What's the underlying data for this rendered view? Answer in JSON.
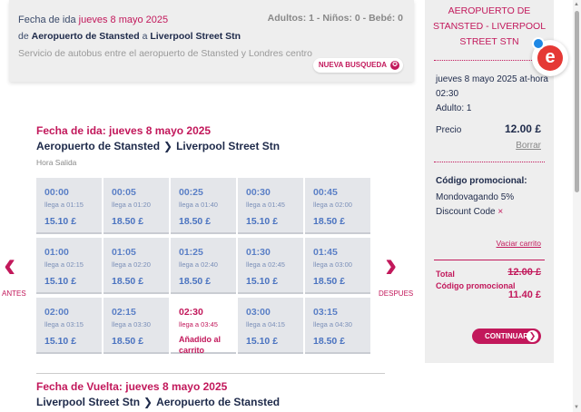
{
  "summary": {
    "label": "Fecha de ida",
    "date": "jueves 8 mayo 2025",
    "passengers": "Adultos: 1 - Niños: 0 - Bebé: 0",
    "de": "de",
    "from": "Aeropuerto de Stansted",
    "a": "a",
    "to": "Liverpool Street Stn",
    "description": "Servicio de autobus entre el aeropuerto de Stansted y Londres centro",
    "new_search": "NUEVA BUSQUEDA",
    "new_search_icon": "✪"
  },
  "outbound": {
    "title": "Fecha de ida: jueves 8 mayo 2025",
    "from": "Aeropuerto de Stansted",
    "to": "Liverpool Street Stn",
    "chevron": "❯",
    "hora_salida": "Hora Salida"
  },
  "departures": [
    {
      "time": "00:00",
      "arrive": "llega a 01:15",
      "price": "15.10 £"
    },
    {
      "time": "00:05",
      "arrive": "llega a 01:20",
      "price": "18.50 £"
    },
    {
      "time": "00:25",
      "arrive": "llega a 01:40",
      "price": "18.50 £"
    },
    {
      "time": "00:30",
      "arrive": "llega a 01:45",
      "price": "15.10 £"
    },
    {
      "time": "00:45",
      "arrive": "llega a 02:00",
      "price": "18.50 £"
    },
    {
      "time": "01:00",
      "arrive": "llega a 02:15",
      "price": "15.10 £"
    },
    {
      "time": "01:05",
      "arrive": "llega a 02:20",
      "price": "18.50 £"
    },
    {
      "time": "01:25",
      "arrive": "llega a 02:40",
      "price": "18.50 £"
    },
    {
      "time": "01:30",
      "arrive": "llega a 02:45",
      "price": "15.10 £"
    },
    {
      "time": "01:45",
      "arrive": "llega a 03:00",
      "price": "18.50 £"
    },
    {
      "time": "02:00",
      "arrive": "llega a 03:15",
      "price": "15.10 £"
    },
    {
      "time": "02:15",
      "arrive": "llega a 03:30",
      "price": "18.50 £"
    },
    {
      "time": "02:30",
      "arrive": "llega a 03:45",
      "price": "",
      "added": "Añadido al carrito",
      "selected": true
    },
    {
      "time": "03:00",
      "arrive": "llega a 04:15",
      "price": "15.10 £"
    },
    {
      "time": "03:15",
      "arrive": "llega a 04:30",
      "price": "18.50 £"
    }
  ],
  "nav": {
    "prev_icon": "‹",
    "prev_label": "ANTES",
    "next_icon": "›",
    "next_label": "DESPUES"
  },
  "return": {
    "title": "Fecha de Vuelta: jueves 8 mayo 2025",
    "from": "Liverpool Street Stn",
    "to": "Aeropuerto de Stansted",
    "chevron": "❯"
  },
  "cart": {
    "route": "AEROPUERTO DE STANSTED - LIVERPOOL STREET STN",
    "trip_info": "jueves 8 mayo 2025 at-hora 02:30",
    "adults": "Adulto: 1",
    "price_label": "Precio",
    "price_value": "12.00 £",
    "delete": "Borrar",
    "promo_title": "Código promocional:",
    "promo_code": "Mondovagando 5% Discount Code",
    "promo_remove": "×",
    "empty_cart": "Vaciar carrito",
    "total_label": "Total",
    "total_old": "12.00 £",
    "code_label": "Código promocional",
    "total_new": "11.40 £",
    "continue": "CONTINUAR",
    "continue_icon": "❯"
  },
  "badge": {
    "letter": "e"
  },
  "colors": {
    "accent": "#c2185b",
    "navy": "#1e2a4a",
    "slot_text": "#5a7fc6",
    "panel": "#eeeeee"
  }
}
